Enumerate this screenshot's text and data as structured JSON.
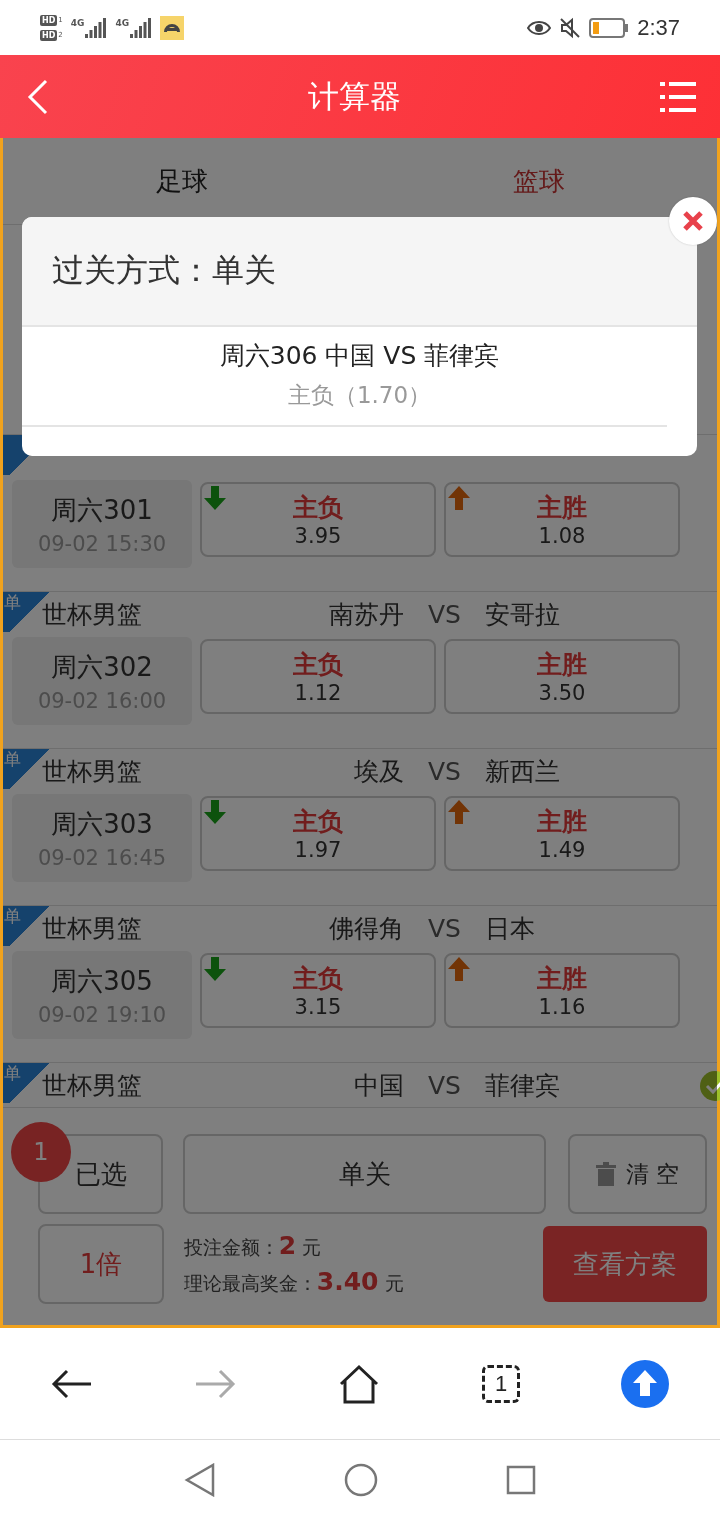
{
  "status_bar": {
    "sim_badges": [
      {
        "label": "HD",
        "slot": "1"
      },
      {
        "label": "HD",
        "slot": "2"
      }
    ],
    "networks": [
      "4G",
      "4G"
    ],
    "time": "2:37"
  },
  "header": {
    "title": "计算器"
  },
  "tabs": [
    {
      "label": "足球",
      "selected": false
    },
    {
      "label": "篮球",
      "selected": true
    }
  ],
  "matches": [
    {
      "number": "周六301",
      "time": "09-02 15:30",
      "checked": false,
      "options": [
        {
          "label": "主负",
          "odds": "3.95",
          "kind": "falling"
        },
        {
          "label": "主胜",
          "odds": "1.08",
          "kind": "rising"
        }
      ]
    },
    {
      "badge": "单",
      "league": "世杯男篮",
      "home": "南苏丹",
      "vs": "VS",
      "away": "安哥拉",
      "number": "周六302",
      "time": "09-02 16:00",
      "checked": false,
      "options": [
        {
          "label": "主负",
          "odds": "1.12",
          "kind": "plain"
        },
        {
          "label": "主胜",
          "odds": "3.50",
          "kind": "plain"
        }
      ]
    },
    {
      "badge": "单",
      "league": "世杯男篮",
      "home": "埃及",
      "vs": "VS",
      "away": "新西兰",
      "number": "周六303",
      "time": "09-02 16:45",
      "checked": false,
      "options": [
        {
          "label": "主负",
          "odds": "1.97",
          "kind": "falling"
        },
        {
          "label": "主胜",
          "odds": "1.49",
          "kind": "rising"
        }
      ]
    },
    {
      "badge": "单",
      "league": "世杯男篮",
      "home": "佛得角",
      "vs": "VS",
      "away": "日本",
      "number": "周六305",
      "time": "09-02 19:10",
      "checked": false,
      "options": [
        {
          "label": "主负",
          "odds": "3.15",
          "kind": "falling"
        },
        {
          "label": "主胜",
          "odds": "1.16",
          "kind": "rising"
        }
      ]
    },
    {
      "badge": "单",
      "league": "世杯男篮",
      "home": "中国",
      "vs": "VS",
      "away": "菲律宾",
      "checked": true
    }
  ],
  "bottom_bar": {
    "count": "1",
    "selected_button": "已选",
    "mode_button": "单关",
    "clear_button": "清 空",
    "multiplier": "1倍",
    "stake": "投注金额：**2** 元",
    "max_prize": "理论最高奖金：**3.40** 元",
    "view_button": "查看方案"
  },
  "dialog": {
    "title": "过关方式：单关",
    "match": "周六306 中国 VS 菲律宾",
    "pick": "主负（1.70）"
  },
  "browser_bar": {
    "tab_count": "1",
    "forward_disabled": true
  }
}
